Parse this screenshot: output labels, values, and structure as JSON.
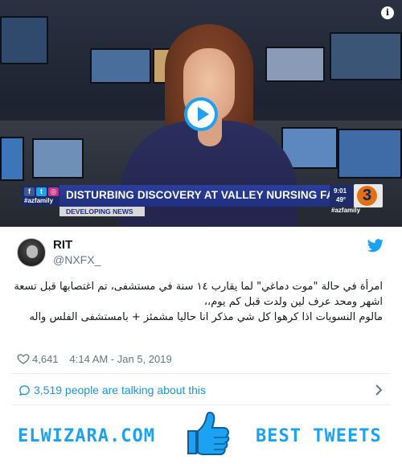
{
  "video": {
    "headline": "DISTURBING DISCOVERY AT VALLEY NURSING FACILITY",
    "subheadline": "DEVELOPING NEWS",
    "time": "9:01",
    "temperature": "49°",
    "channel_logo": "3",
    "social_handle": "#azfamily",
    "hashtag": "#azfamily",
    "social_icons": [
      "f",
      "t",
      "◎"
    ],
    "info_icon": "i",
    "accent_color": "#1da1f2"
  },
  "tweet": {
    "display_name": "RIT",
    "handle": "@NXFX_",
    "text_lines": [
      "امرأة في حالة \"موت دماغي\" لما يقارب ١٤   سنة في مستشفى، تم اغتصابها قبل تسعة",
      "اشهر ومحد عرف لين ولدت قبل كم يوم،،",
      "مالوم النسويات اذا كرهوا كل شي مذكر انا حاليا مشمئز + بامستشفى الفلس واله"
    ],
    "likes": "4,641",
    "timestamp": "4:14 AM - Jan 5, 2019",
    "talking": "3,519 people are talking about this"
  },
  "footer": {
    "brand_left": "ELWIZARA.COM",
    "brand_right": "BEST TWEETS"
  },
  "colors": {
    "twitter_blue": "#1da1f2",
    "link_blue": "#1b95e0",
    "muted": "#657786"
  }
}
